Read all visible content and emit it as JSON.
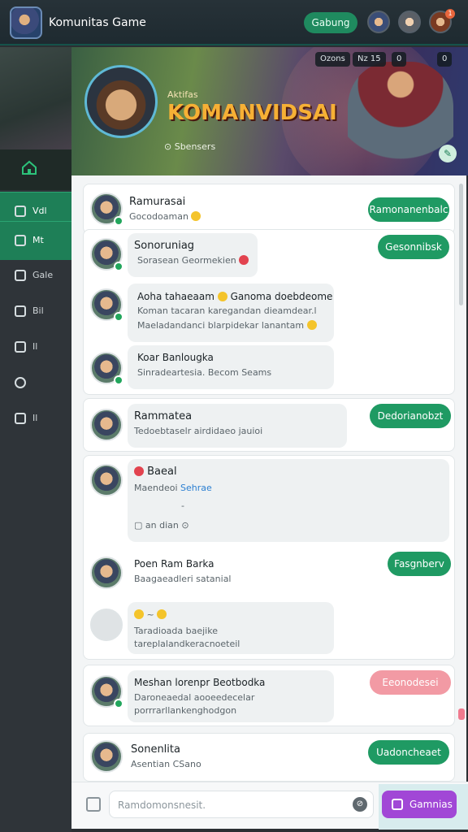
{
  "app": {
    "title": "Komunitas Game",
    "top_button": "Gabung"
  },
  "top_avatars": [
    {
      "badge": ""
    },
    {
      "badge": ""
    },
    {
      "badge": "1"
    }
  ],
  "sidebar": {
    "items": [
      {
        "label": "Vdl"
      },
      {
        "label": "Mt"
      },
      {
        "label": "Gale"
      },
      {
        "label": "Bil"
      },
      {
        "label": "Il"
      },
      {
        "label": ""
      },
      {
        "label": "Il"
      }
    ]
  },
  "hero": {
    "subtitle": "Aktifas",
    "title": "KOMANVIDSAI",
    "meta": "Sbensers",
    "chips": [
      "Ozons",
      "Nz 15",
      "0",
      "0"
    ]
  },
  "feed": {
    "card1": {
      "name": "Ramurasai",
      "message": "Gocodoaman",
      "button": "Ramonanenbalc"
    },
    "card2": {
      "button": "Gesonnibsk",
      "msg1": {
        "name": "Sonoruniag",
        "message": "Sorasean Geormekien"
      },
      "msg2": {
        "text1": "Aoha tahaeaam",
        "text1b": "Ganoma doebdeome",
        "text2": "Koman tacaran karegandan dieamdear.l",
        "text3": "Maeladandanci blarpidekar lanantam"
      },
      "msg3": {
        "name": "Koar Banlougka",
        "message": "Sinradeartesia. Becom Seams"
      }
    },
    "card3": {
      "name": "Rammatea",
      "message": "Tedoebtaselr airdidaeo jauioi",
      "button": "Dedorianobzt"
    },
    "card4": {
      "msg1": {
        "name": "Baeal",
        "message": "Maendeoi",
        "link": "Sehrae",
        "dash": "-",
        "foot": "an dian"
      },
      "msg2": {
        "name": "Poen Ram Barka",
        "message": "Baagaeadleri satanial",
        "button": "Fasgnberv"
      },
      "msg3": {
        "icons": "~",
        "text": "Taradioada baejike tareplalandkeracnoeteil"
      }
    },
    "card5": {
      "name": "Meshan lorenpr Beotbodka",
      "message": "Daroneaedal aooeedecelar porrrarllankenghodgon",
      "button": "Eeonodesei"
    },
    "card6": {
      "name": "Sonenlita",
      "message": "Asentian CSano",
      "button": "Uadoncheaet"
    }
  },
  "composer": {
    "placeholder": "Ramdomonsnesit.",
    "send": "Gamnias"
  }
}
